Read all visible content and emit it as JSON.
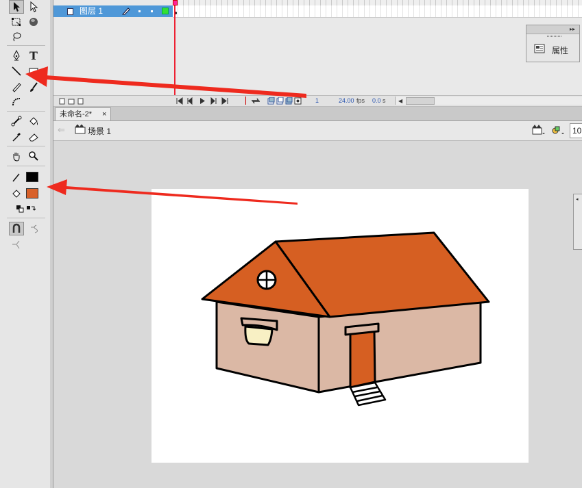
{
  "timeline": {
    "layer_name": "图层 1",
    "current_frame": "1",
    "fps": "24.00",
    "fps_unit": "fps",
    "elapsed": "0.0",
    "elapsed_unit": "s"
  },
  "properties_panel": {
    "label": "属性"
  },
  "document": {
    "tab_label": "未命名-2*",
    "tab_close": "×",
    "scene_label": "场景 1",
    "zoom_value": "10"
  },
  "tools": {
    "text_tool_glyph": "T",
    "stroke_color": "#000000",
    "fill_color": "#d8612a"
  },
  "colors": {
    "roof": "#d65f22",
    "wall": "#dbb8a5",
    "door": "#d65f22",
    "window": "#f8f0c4",
    "arrow": "#ee2a1e",
    "layer_highlight": "#4f98d8"
  }
}
